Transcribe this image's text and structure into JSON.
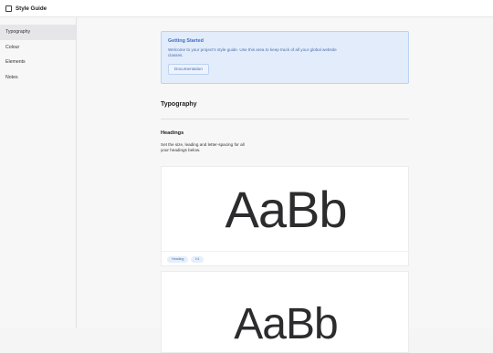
{
  "app": {
    "title": "Style Guide"
  },
  "sidebar": {
    "items": [
      {
        "label": "Typography"
      },
      {
        "label": "Colour"
      },
      {
        "label": "Elements"
      },
      {
        "label": "Notes"
      }
    ]
  },
  "callout": {
    "title": "Getting Started",
    "text": "Welcome to your project's style guide. Use this area to keep track of all your global website classes.",
    "button_label": "Documentation"
  },
  "section": {
    "title": "Typography",
    "subtitle": "Headings",
    "description": "Set the size, leading and letter-spacing for all your headings below."
  },
  "cards": [
    {
      "sample": "AaBb",
      "tags": [
        "Heading",
        "h1"
      ]
    },
    {
      "sample": "AaBb"
    }
  ],
  "colors": {
    "accent": "#3a6fc4",
    "callout_bg": "#e3ecfb"
  },
  "icons": {
    "app_logo": "square-outline-icon"
  }
}
